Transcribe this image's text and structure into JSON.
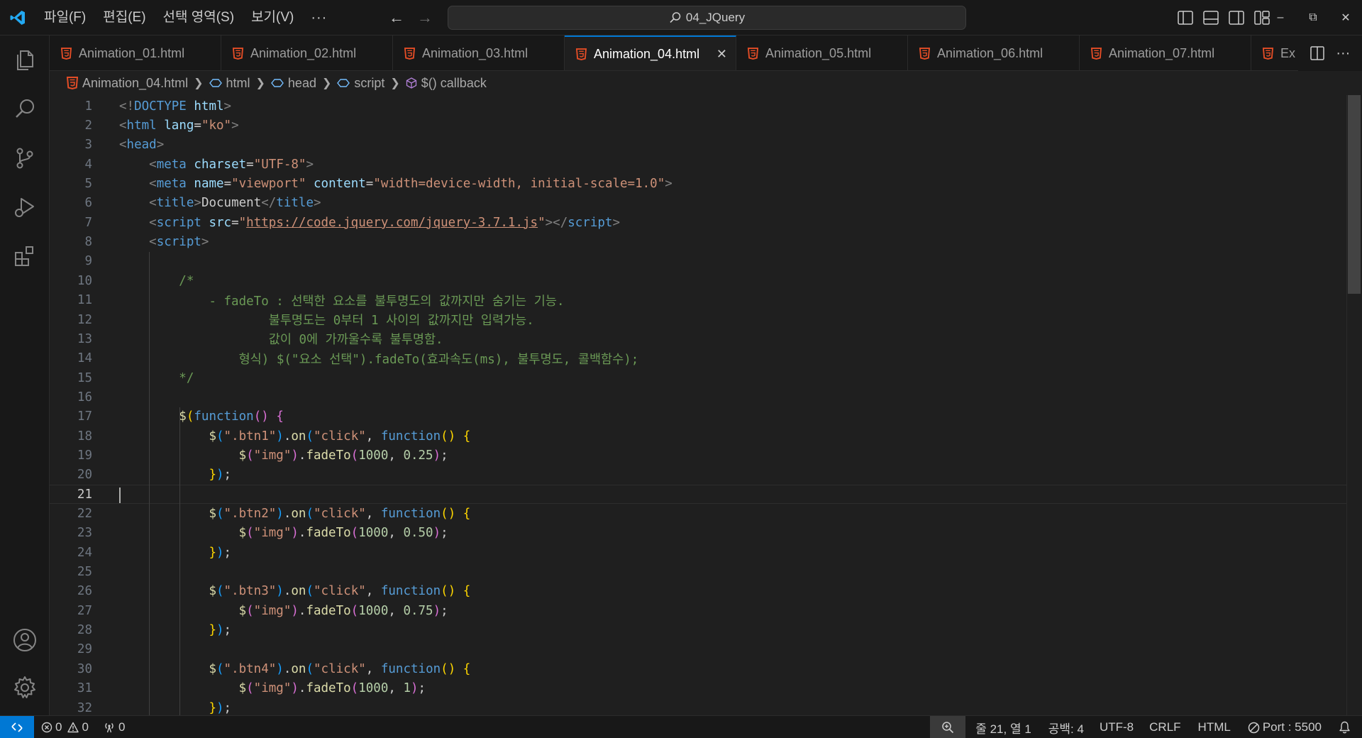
{
  "titlebar": {
    "menus": [
      "파일(F)",
      "편집(E)",
      "선택 영역(S)",
      "보기(V)",
      "···"
    ],
    "search_text": "04_JQuery"
  },
  "activity_bar": {
    "items": [
      "explorer-icon",
      "search-icon",
      "source-control-icon",
      "run-debug-icon",
      "extensions-icon"
    ],
    "bottom_items": [
      "accounts-icon",
      "settings-gear-icon"
    ]
  },
  "tabs": [
    {
      "label": "Animation_01.html",
      "active": false
    },
    {
      "label": "Animation_02.html",
      "active": false
    },
    {
      "label": "Animation_03.html",
      "active": false
    },
    {
      "label": "Animation_04.html",
      "active": true
    },
    {
      "label": "Animation_05.html",
      "active": false
    },
    {
      "label": "Animation_06.html",
      "active": false
    },
    {
      "label": "Animation_07.html",
      "active": false
    },
    {
      "label": "Ex",
      "active": false
    }
  ],
  "breadcrumb": {
    "file": "Animation_04.html",
    "items": [
      "html",
      "head",
      "script",
      "$() callback"
    ]
  },
  "editor": {
    "current_line": 21,
    "line_numbers": [
      "1",
      "2",
      "3",
      "4",
      "5",
      "6",
      "7",
      "8",
      "9",
      "10",
      "11",
      "12",
      "13",
      "14",
      "15",
      "16",
      "17",
      "18",
      "19",
      "20",
      "21",
      "22",
      "23",
      "24",
      "25",
      "26",
      "27",
      "28",
      "29",
      "30",
      "31",
      "32"
    ],
    "lines": [
      [
        [
          "t-punct",
          "<!"
        ],
        [
          "t-tag",
          "DOCTYPE"
        ],
        [
          "t-text",
          " "
        ],
        [
          "t-attr",
          "html"
        ],
        [
          "t-punct",
          ">"
        ]
      ],
      [
        [
          "t-punct",
          "<"
        ],
        [
          "t-tag",
          "html"
        ],
        [
          "t-text",
          " "
        ],
        [
          "t-attr",
          "lang"
        ],
        [
          "t-text",
          "="
        ],
        [
          "t-str",
          "\"ko\""
        ],
        [
          "t-punct",
          ">"
        ]
      ],
      [
        [
          "t-punct",
          "<"
        ],
        [
          "t-tag",
          "head"
        ],
        [
          "t-punct",
          ">"
        ]
      ],
      [
        [
          "t-text",
          "    "
        ],
        [
          "t-punct",
          "<"
        ],
        [
          "t-tag",
          "meta"
        ],
        [
          "t-text",
          " "
        ],
        [
          "t-attr",
          "charset"
        ],
        [
          "t-text",
          "="
        ],
        [
          "t-str",
          "\"UTF-8\""
        ],
        [
          "t-punct",
          ">"
        ]
      ],
      [
        [
          "t-text",
          "    "
        ],
        [
          "t-punct",
          "<"
        ],
        [
          "t-tag",
          "meta"
        ],
        [
          "t-text",
          " "
        ],
        [
          "t-attr",
          "name"
        ],
        [
          "t-text",
          "="
        ],
        [
          "t-str",
          "\"viewport\""
        ],
        [
          "t-text",
          " "
        ],
        [
          "t-attr",
          "content"
        ],
        [
          "t-text",
          "="
        ],
        [
          "t-str",
          "\"width=device-width, initial-scale=1.0\""
        ],
        [
          "t-punct",
          ">"
        ]
      ],
      [
        [
          "t-text",
          "    "
        ],
        [
          "t-punct",
          "<"
        ],
        [
          "t-tag",
          "title"
        ],
        [
          "t-punct",
          ">"
        ],
        [
          "t-text",
          "Document"
        ],
        [
          "t-punct",
          "</"
        ],
        [
          "t-tag",
          "title"
        ],
        [
          "t-punct",
          ">"
        ]
      ],
      [
        [
          "t-text",
          "    "
        ],
        [
          "t-punct",
          "<"
        ],
        [
          "t-tag",
          "script"
        ],
        [
          "t-text",
          " "
        ],
        [
          "t-attr",
          "src"
        ],
        [
          "t-text",
          "="
        ],
        [
          "t-str",
          "\""
        ],
        [
          "t-link",
          "https://code.jquery.com/jquery-3.7.1.js"
        ],
        [
          "t-str",
          "\""
        ],
        [
          "t-punct",
          "></"
        ],
        [
          "t-tag",
          "script"
        ],
        [
          "t-punct",
          ">"
        ]
      ],
      [
        [
          "t-text",
          "    "
        ],
        [
          "t-punct",
          "<"
        ],
        [
          "t-tag",
          "script"
        ],
        [
          "t-punct",
          ">"
        ]
      ],
      [],
      [
        [
          "t-text",
          "        "
        ],
        [
          "t-cmt",
          "/*"
        ]
      ],
      [
        [
          "t-text",
          "            "
        ],
        [
          "t-cmt",
          "- fadeTo : 선택한 요소를 불투명도의 값까지만 숨기는 기능."
        ]
      ],
      [
        [
          "t-text",
          "                    "
        ],
        [
          "t-cmt",
          "불투명도는 0부터 1 사이의 값까지만 입력가능."
        ]
      ],
      [
        [
          "t-text",
          "                    "
        ],
        [
          "t-cmt",
          "값이 0에 가까울수록 불투명함."
        ]
      ],
      [
        [
          "t-text",
          "                "
        ],
        [
          "t-cmt",
          "형식) $(\"요소 선택\").fadeTo(효과속도(ms), 불투명도, 콜백함수);"
        ]
      ],
      [
        [
          "t-text",
          "        "
        ],
        [
          "t-cmt",
          "*/"
        ]
      ],
      [],
      [
        [
          "t-text",
          "        "
        ],
        [
          "t-fn",
          "$"
        ],
        [
          "t-brk1",
          "("
        ],
        [
          "t-kw",
          "function"
        ],
        [
          "t-brk2",
          "()"
        ],
        [
          "t-text",
          " "
        ],
        [
          "t-brk2",
          "{"
        ]
      ],
      [
        [
          "t-text",
          "            "
        ],
        [
          "t-fn",
          "$"
        ],
        [
          "t-brk3",
          "("
        ],
        [
          "t-str",
          "\".btn1\""
        ],
        [
          "t-brk3",
          ")"
        ],
        [
          "t-text",
          "."
        ],
        [
          "t-fn",
          "on"
        ],
        [
          "t-brk3",
          "("
        ],
        [
          "t-str",
          "\"click\""
        ],
        [
          "t-text",
          ", "
        ],
        [
          "t-kw",
          "function"
        ],
        [
          "t-brk1",
          "()"
        ],
        [
          "t-text",
          " "
        ],
        [
          "t-brk1",
          "{"
        ]
      ],
      [
        [
          "t-text",
          "                "
        ],
        [
          "t-fn",
          "$"
        ],
        [
          "t-brk2",
          "("
        ],
        [
          "t-str",
          "\"img\""
        ],
        [
          "t-brk2",
          ")"
        ],
        [
          "t-text",
          "."
        ],
        [
          "t-fn",
          "fadeTo"
        ],
        [
          "t-brk2",
          "("
        ],
        [
          "t-num",
          "1000"
        ],
        [
          "t-text",
          ", "
        ],
        [
          "t-num",
          "0.25"
        ],
        [
          "t-brk2",
          ")"
        ],
        [
          "t-text",
          ";"
        ]
      ],
      [
        [
          "t-text",
          "            "
        ],
        [
          "t-brk1",
          "}"
        ],
        [
          "t-brk3",
          ")"
        ],
        [
          "t-text",
          ";"
        ]
      ],
      [],
      [
        [
          "t-text",
          "            "
        ],
        [
          "t-fn",
          "$"
        ],
        [
          "t-brk3",
          "("
        ],
        [
          "t-str",
          "\".btn2\""
        ],
        [
          "t-brk3",
          ")"
        ],
        [
          "t-text",
          "."
        ],
        [
          "t-fn",
          "on"
        ],
        [
          "t-brk3",
          "("
        ],
        [
          "t-str",
          "\"click\""
        ],
        [
          "t-text",
          ", "
        ],
        [
          "t-kw",
          "function"
        ],
        [
          "t-brk1",
          "()"
        ],
        [
          "t-text",
          " "
        ],
        [
          "t-brk1",
          "{"
        ]
      ],
      [
        [
          "t-text",
          "                "
        ],
        [
          "t-fn",
          "$"
        ],
        [
          "t-brk2",
          "("
        ],
        [
          "t-str",
          "\"img\""
        ],
        [
          "t-brk2",
          ")"
        ],
        [
          "t-text",
          "."
        ],
        [
          "t-fn",
          "fadeTo"
        ],
        [
          "t-brk2",
          "("
        ],
        [
          "t-num",
          "1000"
        ],
        [
          "t-text",
          ", "
        ],
        [
          "t-num",
          "0.50"
        ],
        [
          "t-brk2",
          ")"
        ],
        [
          "t-text",
          ";"
        ]
      ],
      [
        [
          "t-text",
          "            "
        ],
        [
          "t-brk1",
          "}"
        ],
        [
          "t-brk3",
          ")"
        ],
        [
          "t-text",
          ";"
        ]
      ],
      [],
      [
        [
          "t-text",
          "            "
        ],
        [
          "t-fn",
          "$"
        ],
        [
          "t-brk3",
          "("
        ],
        [
          "t-str",
          "\".btn3\""
        ],
        [
          "t-brk3",
          ")"
        ],
        [
          "t-text",
          "."
        ],
        [
          "t-fn",
          "on"
        ],
        [
          "t-brk3",
          "("
        ],
        [
          "t-str",
          "\"click\""
        ],
        [
          "t-text",
          ", "
        ],
        [
          "t-kw",
          "function"
        ],
        [
          "t-brk1",
          "()"
        ],
        [
          "t-text",
          " "
        ],
        [
          "t-brk1",
          "{"
        ]
      ],
      [
        [
          "t-text",
          "                "
        ],
        [
          "t-fn",
          "$"
        ],
        [
          "t-brk2",
          "("
        ],
        [
          "t-str",
          "\"img\""
        ],
        [
          "t-brk2",
          ")"
        ],
        [
          "t-text",
          "."
        ],
        [
          "t-fn",
          "fadeTo"
        ],
        [
          "t-brk2",
          "("
        ],
        [
          "t-num",
          "1000"
        ],
        [
          "t-text",
          ", "
        ],
        [
          "t-num",
          "0.75"
        ],
        [
          "t-brk2",
          ")"
        ],
        [
          "t-text",
          ";"
        ]
      ],
      [
        [
          "t-text",
          "            "
        ],
        [
          "t-brk1",
          "}"
        ],
        [
          "t-brk3",
          ")"
        ],
        [
          "t-text",
          ";"
        ]
      ],
      [],
      [
        [
          "t-text",
          "            "
        ],
        [
          "t-fn",
          "$"
        ],
        [
          "t-brk3",
          "("
        ],
        [
          "t-str",
          "\".btn4\""
        ],
        [
          "t-brk3",
          ")"
        ],
        [
          "t-text",
          "."
        ],
        [
          "t-fn",
          "on"
        ],
        [
          "t-brk3",
          "("
        ],
        [
          "t-str",
          "\"click\""
        ],
        [
          "t-text",
          ", "
        ],
        [
          "t-kw",
          "function"
        ],
        [
          "t-brk1",
          "()"
        ],
        [
          "t-text",
          " "
        ],
        [
          "t-brk1",
          "{"
        ]
      ],
      [
        [
          "t-text",
          "                "
        ],
        [
          "t-fn",
          "$"
        ],
        [
          "t-brk2",
          "("
        ],
        [
          "t-str",
          "\"img\""
        ],
        [
          "t-brk2",
          ")"
        ],
        [
          "t-text",
          "."
        ],
        [
          "t-fn",
          "fadeTo"
        ],
        [
          "t-brk2",
          "("
        ],
        [
          "t-num",
          "1000"
        ],
        [
          "t-text",
          ", "
        ],
        [
          "t-num",
          "1"
        ],
        [
          "t-brk2",
          ")"
        ],
        [
          "t-text",
          ";"
        ]
      ],
      [
        [
          "t-text",
          "            "
        ],
        [
          "t-brk1",
          "}"
        ],
        [
          "t-brk3",
          ")"
        ],
        [
          "t-text",
          ";"
        ]
      ]
    ]
  },
  "statusbar": {
    "errors": "0",
    "warnings": "0",
    "ports": "0",
    "cursor_position": "줄 21, 열 1",
    "indentation": "공백: 4",
    "encoding": "UTF-8",
    "line_ending": "CRLF",
    "language": "HTML",
    "live_server": "Port : 5500"
  },
  "colors": {
    "accent": "#0078d4",
    "html_icon": "#e44d26",
    "editor_bg": "#1f1f1f",
    "chrome_bg": "#181818"
  }
}
